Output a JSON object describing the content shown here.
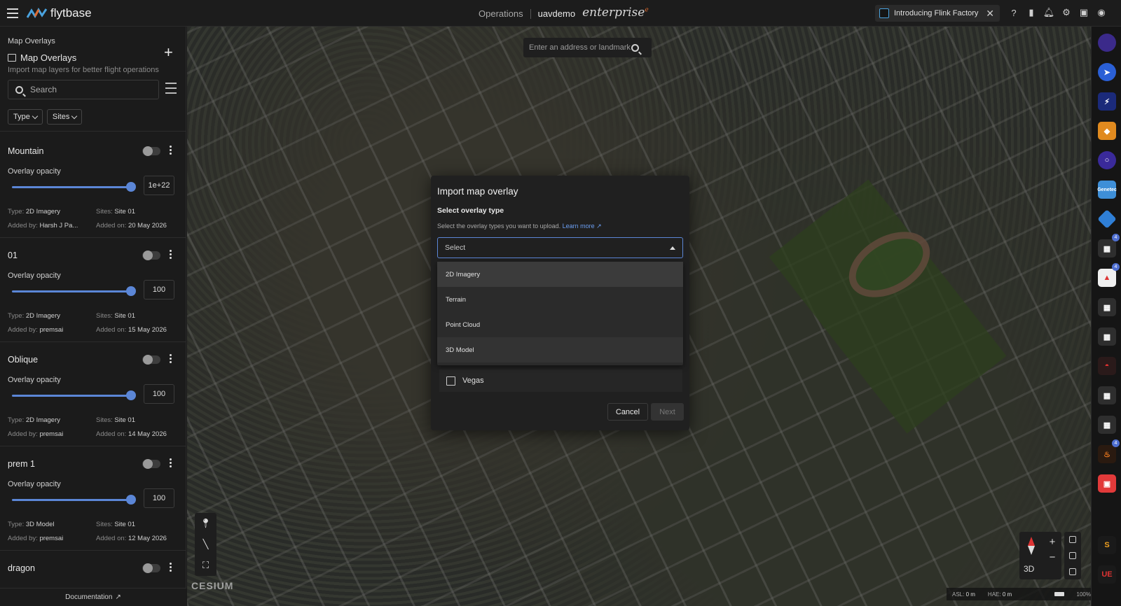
{
  "topbar": {
    "brand": "flytbase",
    "section": "Operations",
    "org": "uavdemo",
    "edition": "enterprise",
    "edition_mark": "e",
    "promo": "Introducing Flink Factory"
  },
  "sidebar": {
    "crumb": "Map Overlays",
    "title": "Map Overlays",
    "subtitle": "Import map layers for better flight operations",
    "search_placeholder": "Search",
    "filters": [
      "Type",
      "Sites"
    ],
    "opacity_label": "Overlay opacity",
    "labels": {
      "type": "Type:",
      "sites": "Sites:",
      "added_by": "Added by:",
      "added_on": "Added on:"
    },
    "items": [
      {
        "name": "Mountain",
        "opacity": "1e+22",
        "type": "2D Imagery",
        "sites": "Site 01",
        "added_by": "Harsh J Pa...",
        "added_on": "20 May 2026"
      },
      {
        "name": "01",
        "opacity": "100",
        "type": "2D Imagery",
        "sites": "Site 01",
        "added_by": "premsai",
        "added_on": "15 May 2026"
      },
      {
        "name": "Oblique",
        "opacity": "100",
        "type": "2D Imagery",
        "sites": "Site 01",
        "added_by": "premsai",
        "added_on": "14 May 2026"
      },
      {
        "name": "prem 1",
        "opacity": "100",
        "type": "3D Model",
        "sites": "Site 01",
        "added_by": "premsai",
        "added_on": "12 May 2026"
      },
      {
        "name": "dragon"
      }
    ],
    "footer": "Documentation"
  },
  "map": {
    "search_placeholder": "Enter an address or landmark...",
    "attribution": "CESIUM",
    "view_mode": "3D",
    "status": {
      "asl_label": "ASL:",
      "asl": "0 m",
      "hae_label": "HAE:",
      "hae": "0 m",
      "battery": "100%"
    }
  },
  "rail": {
    "badges": [
      "4",
      "4",
      "4"
    ],
    "icon_labels": {
      "genetec": "Genetec"
    }
  },
  "modal": {
    "title": "Import map overlay",
    "subtitle": "Select overlay type",
    "help": "Select the overlay types you want to upload.",
    "learn_more": "Learn more",
    "select_placeholder": "Select",
    "options": [
      "2D Imagery",
      "Terrain",
      "Point Cloud",
      "3D Model"
    ],
    "site": "Vegas",
    "cancel": "Cancel",
    "next": "Next"
  },
  "colors": {
    "accent": "#5b86d6",
    "brand_orange": "#e06b2f"
  }
}
